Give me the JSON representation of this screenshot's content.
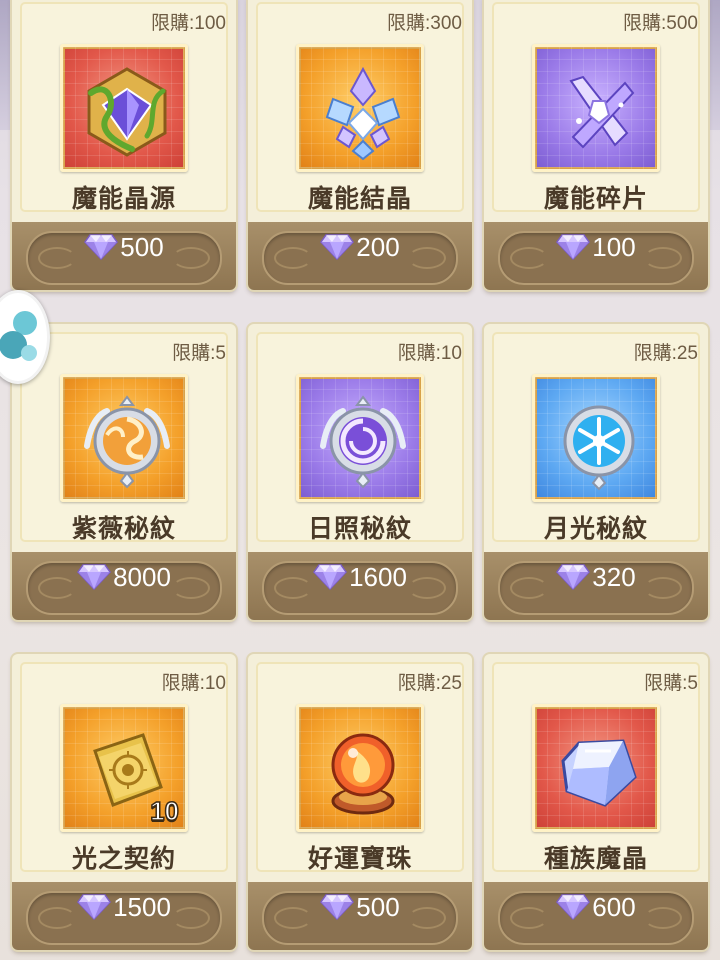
{
  "colors": {
    "card_bg": "#f4efd9",
    "price_bar": "#8e7551",
    "text_dark": "#4a3a28"
  },
  "currency_icon": "diamond-gem-icon",
  "items": [
    {
      "name": "魔能晶源",
      "limit": "限購:100",
      "price": "500",
      "frame": "red",
      "icon": "vine-crystal-cube-icon",
      "qty": ""
    },
    {
      "name": "魔能結晶",
      "limit": "限購:300",
      "price": "200",
      "frame": "orange",
      "icon": "crystal-cluster-icon",
      "qty": ""
    },
    {
      "name": "魔能碎片",
      "limit": "限購:500",
      "price": "100",
      "frame": "purple",
      "icon": "crystal-shards-icon",
      "qty": ""
    },
    {
      "name": "紫薇秘紋",
      "limit": "限購:5",
      "price": "8000",
      "frame": "orange",
      "icon": "swirl-emblem-icon",
      "qty": ""
    },
    {
      "name": "日照秘紋",
      "limit": "限購:10",
      "price": "1600",
      "frame": "purple",
      "icon": "sun-emblem-icon",
      "qty": ""
    },
    {
      "name": "月光秘紋",
      "limit": "限購:25",
      "price": "320",
      "frame": "blue",
      "icon": "snowflake-emblem-icon",
      "qty": ""
    },
    {
      "name": "光之契約",
      "limit": "限購:10",
      "price": "1500",
      "frame": "orange",
      "icon": "golden-book-icon",
      "qty": "10"
    },
    {
      "name": "好運寶珠",
      "limit": "限購:25",
      "price": "500",
      "frame": "orange",
      "icon": "fire-orb-icon",
      "qty": ""
    },
    {
      "name": "種族魔晶",
      "limit": "限購:5",
      "price": "600",
      "frame": "red",
      "icon": "blue-crystal-cube-icon",
      "qty": ""
    }
  ]
}
